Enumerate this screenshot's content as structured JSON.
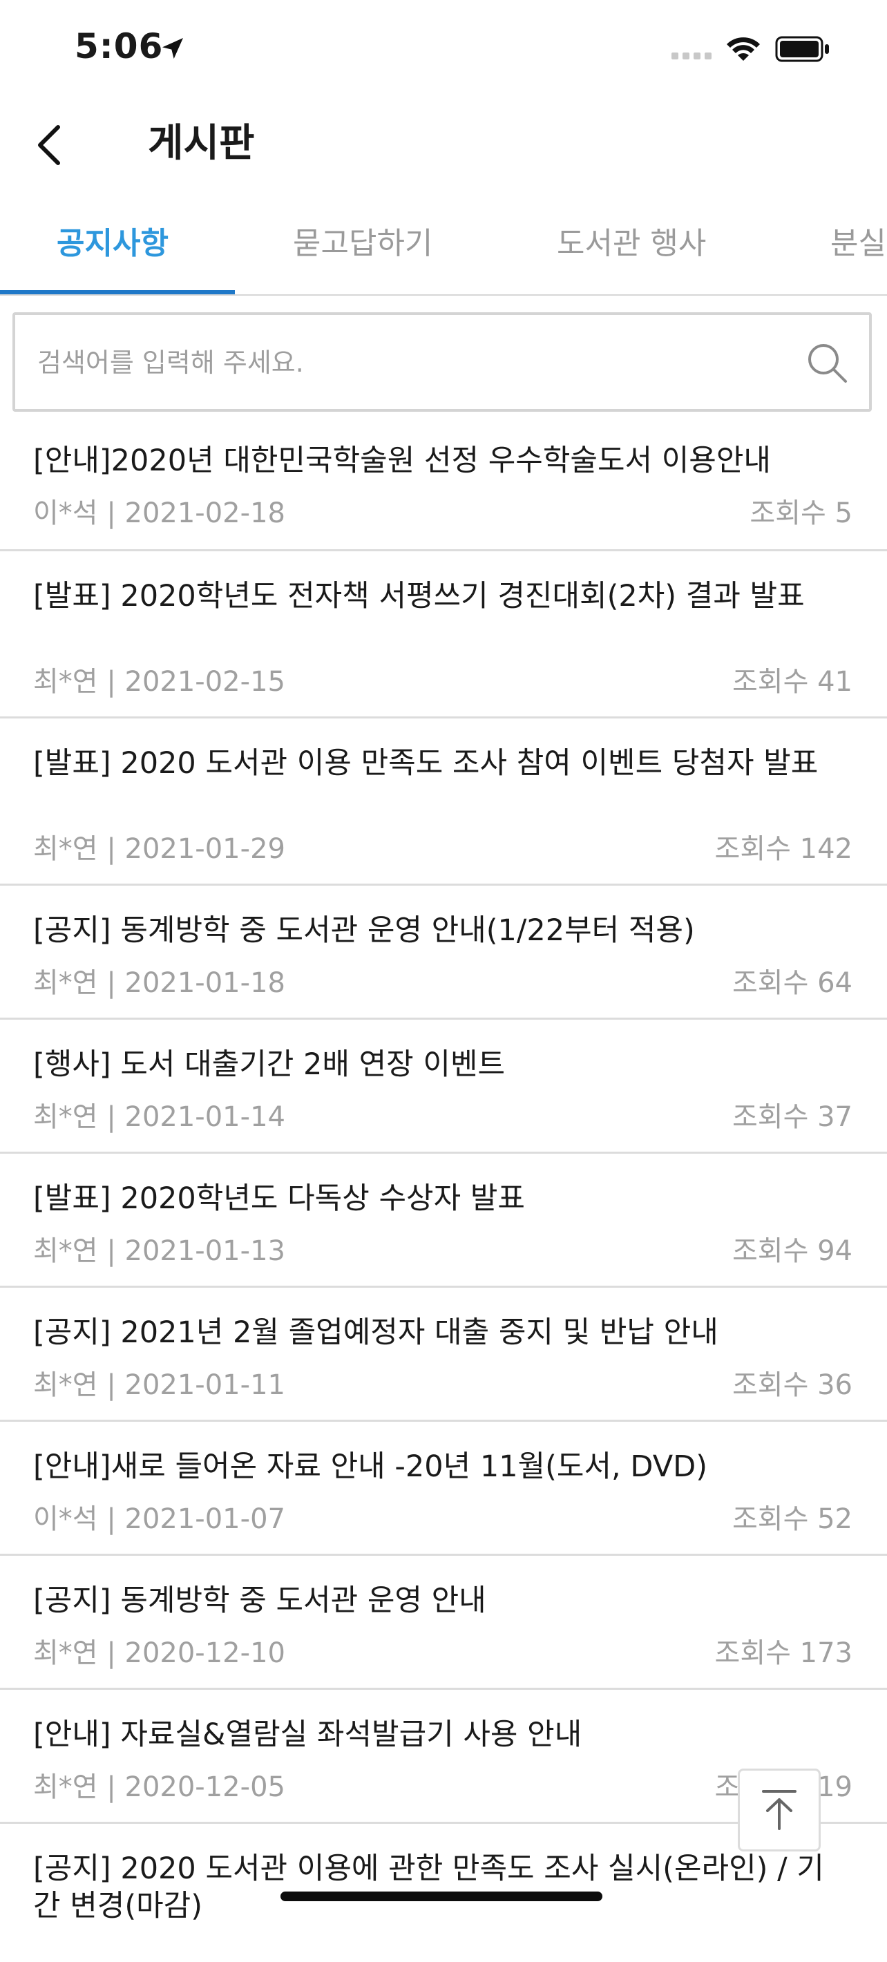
{
  "status_bar": {
    "time": "5:06"
  },
  "header": {
    "title": "게시판"
  },
  "tabs": [
    {
      "label": "공지사항",
      "active": true
    },
    {
      "label": "묻고답하기",
      "active": false
    },
    {
      "label": "도서관 행사",
      "active": false
    },
    {
      "label": "분실",
      "active": false
    }
  ],
  "search": {
    "placeholder": "검색어를 입력해 주세요."
  },
  "posts": [
    {
      "title": "[안내]2020년 대한민국학술원 선정 우수학술도서 이용안내",
      "meta": "이*석 | 2021-02-18",
      "views": "조회수 5"
    },
    {
      "title": "[발표] 2020학년도 전자책 서평쓰기 경진대회(2차) 결과 발표",
      "meta": "최*연 | 2021-02-15",
      "views": "조회수 41"
    },
    {
      "title": "[발표] 2020 도서관 이용 만족도 조사 참여 이벤트 당첨자 발표",
      "meta": "최*연 | 2021-01-29",
      "views": "조회수 142"
    },
    {
      "title": "[공지] 동계방학 중 도서관 운영 안내(1/22부터 적용)",
      "meta": "최*연 | 2021-01-18",
      "views": "조회수 64"
    },
    {
      "title": "[행사] 도서 대출기간 2배 연장 이벤트",
      "meta": "최*연 | 2021-01-14",
      "views": "조회수 37"
    },
    {
      "title": "[발표] 2020학년도 다독상 수상자 발표",
      "meta": "최*연 | 2021-01-13",
      "views": "조회수 94"
    },
    {
      "title": "[공지] 2021년 2월 졸업예정자 대출 중지 및 반납 안내",
      "meta": "최*연 | 2021-01-11",
      "views": "조회수 36"
    },
    {
      "title": " [안내]새로 들어온 자료 안내 -20년 11월(도서, DVD)",
      "meta": "이*석 | 2021-01-07",
      "views": "조회수 52"
    },
    {
      "title": "[공지] 동계방학 중 도서관 운영 안내",
      "meta": "최*연 | 2020-12-10",
      "views": "조회수 173"
    },
    {
      "title": "[안내] 자료실&열람실 좌석발급기 사용 안내",
      "meta": "최*연 | 2020-12-05",
      "views": "조회수 119"
    },
    {
      "title": "[공지] 2020 도서관 이용에 관한 만족도 조사 실시(온라인) / 기간 변경(마감)",
      "meta": "",
      "views": ""
    }
  ],
  "colors": {
    "accent": "#2d97dd",
    "indicator": "#1f78c8",
    "muted": "#a0a0a0",
    "divider": "#dcdcdc"
  }
}
